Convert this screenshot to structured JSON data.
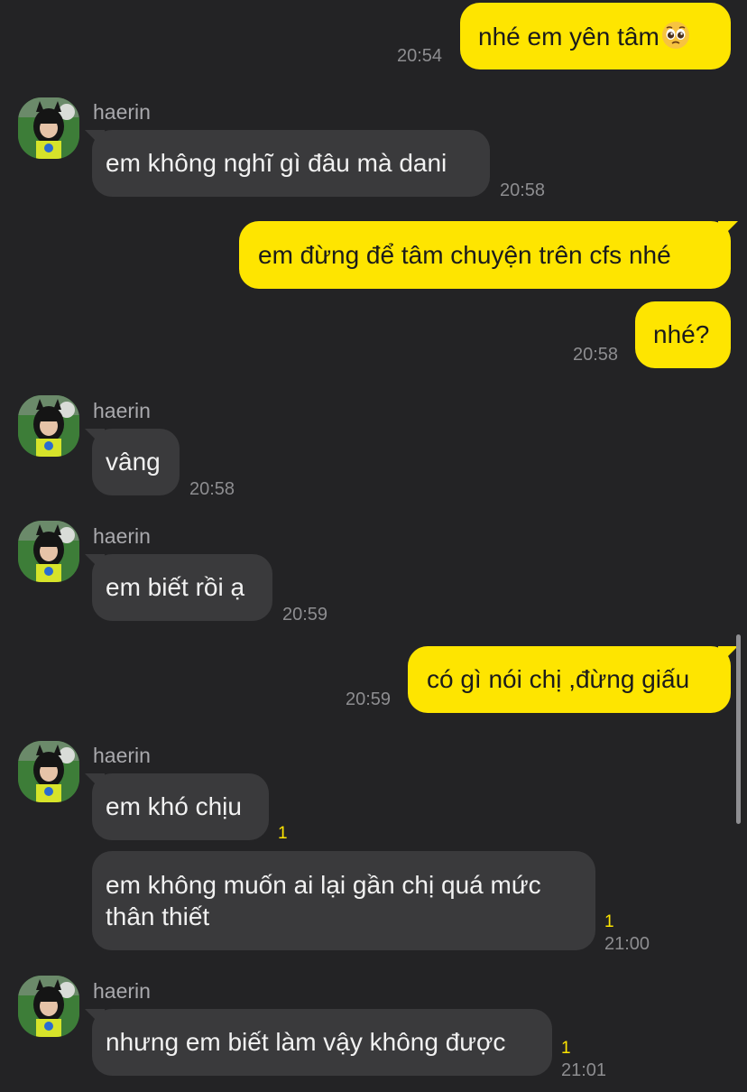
{
  "contact": {
    "name": "haerin"
  },
  "messages": [
    {
      "id": "m1",
      "side": "out",
      "text": "nhé em yên tâm",
      "emoji": "pleading-face-icon",
      "time": "20:54"
    },
    {
      "id": "m2",
      "side": "in",
      "text": "em không nghĩ gì đâu mà dani",
      "time": "20:58"
    },
    {
      "id": "m3",
      "side": "out",
      "text": "em đừng để tâm chuyện trên cfs nhé",
      "time": ""
    },
    {
      "id": "m4",
      "side": "out",
      "text": "nhé?",
      "time": "20:58"
    },
    {
      "id": "m5",
      "side": "in",
      "text": "vâng",
      "time": "20:58"
    },
    {
      "id": "m6",
      "side": "in",
      "text": "em biết rồi ạ",
      "time": "20:59"
    },
    {
      "id": "m7",
      "side": "out",
      "text": "có gì nói chị ,đừng giấu",
      "time": "20:59"
    },
    {
      "id": "m8",
      "side": "in",
      "text": "em khó chịu",
      "unread": "1",
      "time": ""
    },
    {
      "id": "m9",
      "side": "in",
      "text": "em không muốn ai lại gần chị quá mức thân thiết",
      "unread": "1",
      "time": "21:00"
    },
    {
      "id": "m10",
      "side": "in",
      "text": "nhưng em biết làm vậy không được",
      "unread": "1",
      "time": "21:01"
    }
  ],
  "colors": {
    "background": "#232325",
    "outgoing_bubble": "#FEE500",
    "incoming_bubble": "#3a3a3c",
    "unread": "#FEE500"
  }
}
